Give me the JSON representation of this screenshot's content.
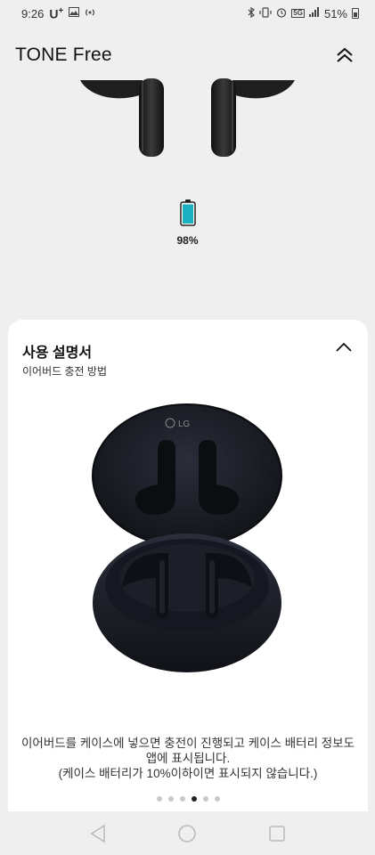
{
  "status_bar": {
    "time": "9:26",
    "carrier": "U",
    "carrier_sup": "+",
    "network": "5G",
    "battery": "51%"
  },
  "header": {
    "title": "TONE Free",
    "collapse_icon": "double-chevron-up-icon"
  },
  "device": {
    "battery_percent": "98%",
    "battery_level": 0.98,
    "battery_color": "#1ab0c0"
  },
  "card": {
    "title": "사용 설명서",
    "subtitle": "이어버드 충전 방법",
    "toggle_icon": "chevron-up-icon",
    "case_logo": "LG",
    "description_line1": "이어버드를 케이스에 넣으면 충전이 진행되고 케이스 배터리 정보도",
    "description_line2": "앱에 표시됩니다.",
    "description_line3": "(케이스 배터리가 10%이하이면 표시되지 않습니다.)",
    "pager": {
      "total": 6,
      "active_index": 3
    }
  },
  "nav": {
    "back_icon": "back-triangle-icon",
    "home_icon": "home-circle-icon",
    "recents_icon": "recents-square-icon"
  }
}
